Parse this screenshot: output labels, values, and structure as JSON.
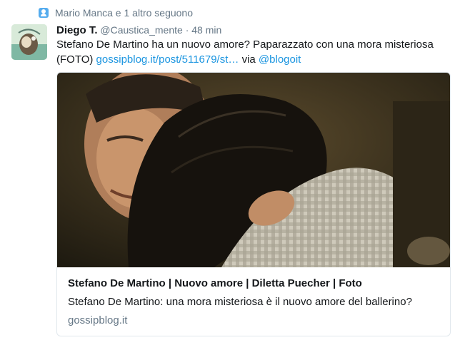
{
  "context": {
    "text": "Mario Manca e 1 altro seguono"
  },
  "tweet": {
    "name": "Diego T.",
    "handle": "@Caustica_mente",
    "separator": "·",
    "time": "48 min",
    "text_line1": "Stefano De Martino ha un nuovo amore? Paparazzato con una mora misteriosa",
    "text_prefix": "(FOTO) ",
    "link": "gossipblog.it/post/511679/st…",
    "via_text": " via ",
    "via_mention": "@blogoit"
  },
  "card": {
    "title": "Stefano De Martino | Nuovo amore | Diletta Puecher | Foto",
    "description": "Stefano De Martino: una mora misteriosa è il nuovo amore del ballerino?",
    "domain": "gossipblog.it"
  },
  "colors": {
    "link": "#1b95e0",
    "muted": "#657786",
    "text": "#14171a",
    "border": "#e1e8ed"
  }
}
